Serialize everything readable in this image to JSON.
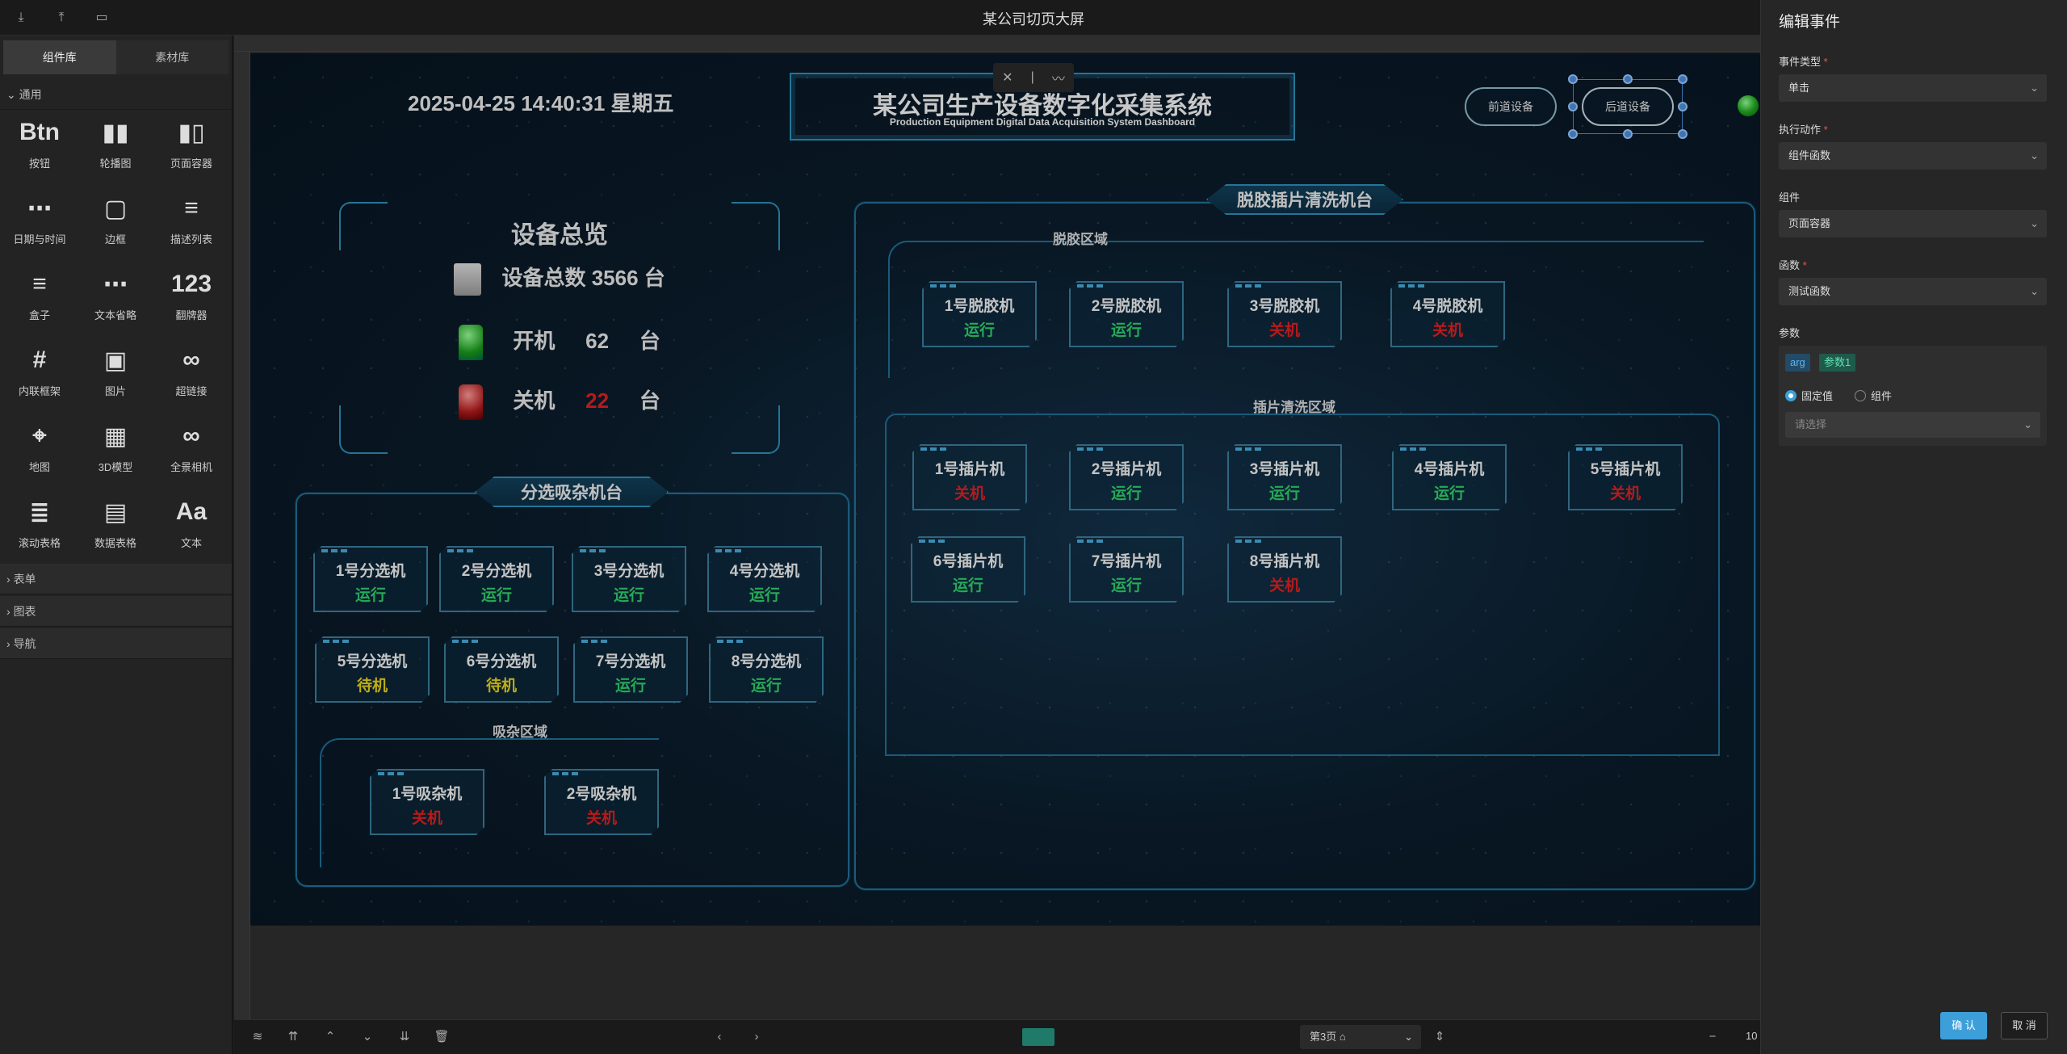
{
  "app": {
    "title": "某公司切页大屏"
  },
  "left": {
    "tabs": [
      "组件库",
      "素材库"
    ],
    "groups": {
      "common": "通用",
      "form": "表单",
      "chart": "图表",
      "nav": "导航"
    },
    "components": [
      "按钮",
      "轮播图",
      "页面容器",
      "日期与时间",
      "边框",
      "描述列表",
      "盒子",
      "文本省略",
      "翻牌器",
      "内联框架",
      "图片",
      "超链接",
      "地图",
      "3D模型",
      "全景相机",
      "滚动表格",
      "数据表格",
      "文本"
    ]
  },
  "screen": {
    "datetime": "2025-04-25 14:40:31 星期五",
    "title_zh": "某公司生产设备数字化采集系统",
    "title_en": "Production Equipment Digital Data Acquisition System Dashboard",
    "btn_prev": "前道设备",
    "btn_next": "后道设备",
    "overview": {
      "title": "设备总览",
      "total": "设备总数 3566 台",
      "on_label": "开机",
      "on_count": "62",
      "off_label": "关机",
      "off_count": "22",
      "unit": "台"
    },
    "sort_panel": {
      "title": "分选吸杂机台",
      "zone": "吸杂区域",
      "machines": [
        {
          "name": "1号分选机",
          "status": "运行",
          "cls": "run"
        },
        {
          "name": "2号分选机",
          "status": "运行",
          "cls": "run"
        },
        {
          "name": "3号分选机",
          "status": "运行",
          "cls": "run"
        },
        {
          "name": "4号分选机",
          "status": "运行",
          "cls": "run"
        },
        {
          "name": "5号分选机",
          "status": "待机",
          "cls": "wait"
        },
        {
          "name": "6号分选机",
          "status": "待机",
          "cls": "wait"
        },
        {
          "name": "7号分选机",
          "status": "运行",
          "cls": "run"
        },
        {
          "name": "8号分选机",
          "status": "运行",
          "cls": "run"
        }
      ],
      "absorb": [
        {
          "name": "1号吸杂机",
          "status": "关机",
          "cls": "stop"
        },
        {
          "name": "2号吸杂机",
          "status": "关机",
          "cls": "stop"
        }
      ]
    },
    "clean_panel": {
      "title": "脱胶插片清洗机台",
      "zone1": "脱胶区域",
      "zone2": "插片清洗区域",
      "degum": [
        {
          "name": "1号脱胶机",
          "status": "运行",
          "cls": "run"
        },
        {
          "name": "2号脱胶机",
          "status": "运行",
          "cls": "run"
        },
        {
          "name": "3号脱胶机",
          "status": "关机",
          "cls": "stop"
        },
        {
          "name": "4号脱胶机",
          "status": "关机",
          "cls": "stop"
        }
      ],
      "insert": [
        {
          "name": "1号插片机",
          "status": "关机",
          "cls": "stop"
        },
        {
          "name": "2号插片机",
          "status": "运行",
          "cls": "run"
        },
        {
          "name": "3号插片机",
          "status": "运行",
          "cls": "run"
        },
        {
          "name": "4号插片机",
          "status": "运行",
          "cls": "run"
        },
        {
          "name": "5号插片机",
          "status": "关机",
          "cls": "stop"
        },
        {
          "name": "6号插片机",
          "status": "运行",
          "cls": "run"
        },
        {
          "name": "7号插片机",
          "status": "运行",
          "cls": "run"
        },
        {
          "name": "8号插片机",
          "status": "关机",
          "cls": "stop"
        }
      ]
    }
  },
  "bottom": {
    "page": "第3页",
    "zoom": "10"
  },
  "right": {
    "title": "编辑事件",
    "event_type_label": "事件类型",
    "event_type": "单击",
    "action_label": "执行动作",
    "action": "组件函数",
    "component_label": "组件",
    "component": "页面容器",
    "func_label": "函数",
    "func": "测试函数",
    "param_label": "参数",
    "tag_arg": "arg",
    "tag_param": "参数1",
    "radio_fixed": "固定值",
    "radio_comp": "组件",
    "select_placeholder": "请选择",
    "confirm": "确 认",
    "cancel": "取 消"
  },
  "colors": {
    "accent": "#3d9fd9",
    "run": "#2fcf6a",
    "stop": "#e02020",
    "wait": "#e6d21a",
    "panel_border": "#1f6f95"
  }
}
